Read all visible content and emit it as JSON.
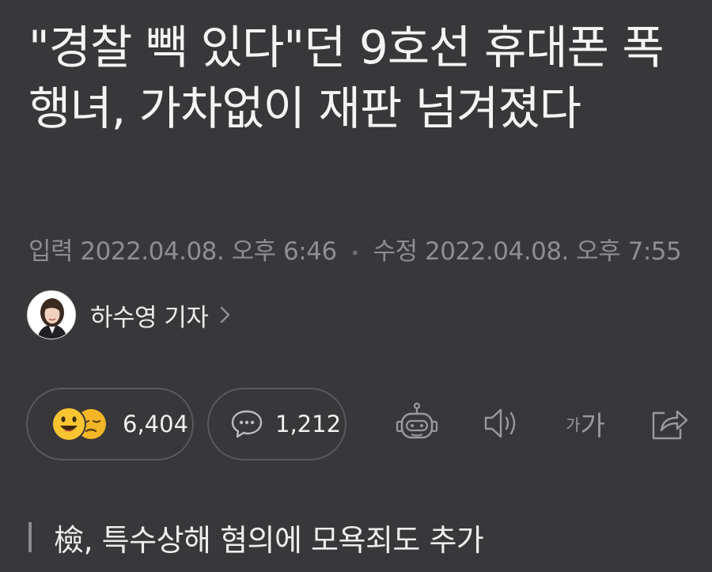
{
  "article": {
    "headline": "\"경찰 빽 있다\"던 9호선 휴대폰 폭행녀, 가차없이 재판 넘겨졌다",
    "meta": {
      "input_label": "입력",
      "input_time": "2022.04.08. 오후 6:46",
      "separator": "•",
      "edit_label": "수정",
      "edit_time": "2022.04.08. 오후 7:55"
    },
    "author": {
      "name": "하수영 기자",
      "chevron": ">"
    },
    "reactions": {
      "count": "6,404",
      "icons": [
        "smile-emoji-icon",
        "sad-emoji-icon"
      ],
      "colors": {
        "emoji": "#f6c02c"
      }
    },
    "comments": {
      "count": "1,212",
      "icon": "comment-bubble-icon"
    },
    "toolbar": {
      "summary_icon": "robot-icon",
      "tts_icon": "speaker-icon",
      "font_size_small": "가",
      "font_size_big": "가",
      "share_icon": "share-icon"
    },
    "subheadline": "檢, 특수상해 혐의에 모욕죄도 추가"
  },
  "colors": {
    "background": "#38373a",
    "headline": "#f4f4f4",
    "meta": "#8e8e92",
    "pill_border": "#5a595d",
    "icon": "#9a9a9e"
  }
}
